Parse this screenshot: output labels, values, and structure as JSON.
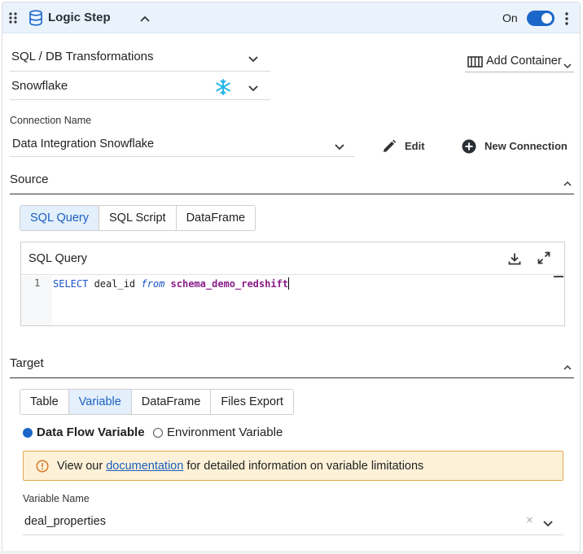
{
  "header": {
    "title": "Logic Step",
    "toggle_label": "On",
    "toggle_state": "on",
    "accent_color": "#1b66c9"
  },
  "transform_select": {
    "value": "SQL / DB Transformations"
  },
  "database_select": {
    "value": "Snowflake",
    "icon": "snowflake-icon"
  },
  "add_container": {
    "label": "Add Container"
  },
  "connection": {
    "label": "Connection Name",
    "value": "Data Integration Snowflake",
    "edit_label": "Edit",
    "new_label": "New Connection"
  },
  "source": {
    "title": "Source",
    "tabs": [
      "SQL Query",
      "SQL Script",
      "DataFrame"
    ],
    "active_tab": "SQL Query",
    "editor": {
      "title": "SQL Query",
      "line_number": "1",
      "tokens": {
        "kw1": "SELECT",
        "col": " deal_id ",
        "kw2": "from",
        "table": " schema_demo_redshift"
      }
    }
  },
  "target": {
    "title": "Target",
    "tabs": [
      "Table",
      "Variable",
      "DataFrame",
      "Files Export"
    ],
    "active_tab": "Variable",
    "radio_selected": "Data Flow Variable",
    "radio_other": "Environment Variable",
    "banner": {
      "prefix": "View our ",
      "link": "documentation",
      "suffix": " for detailed information on variable limitations"
    },
    "variable_label": "Variable Name",
    "variable_value": "deal_properties",
    "clear_glyph": "×"
  }
}
